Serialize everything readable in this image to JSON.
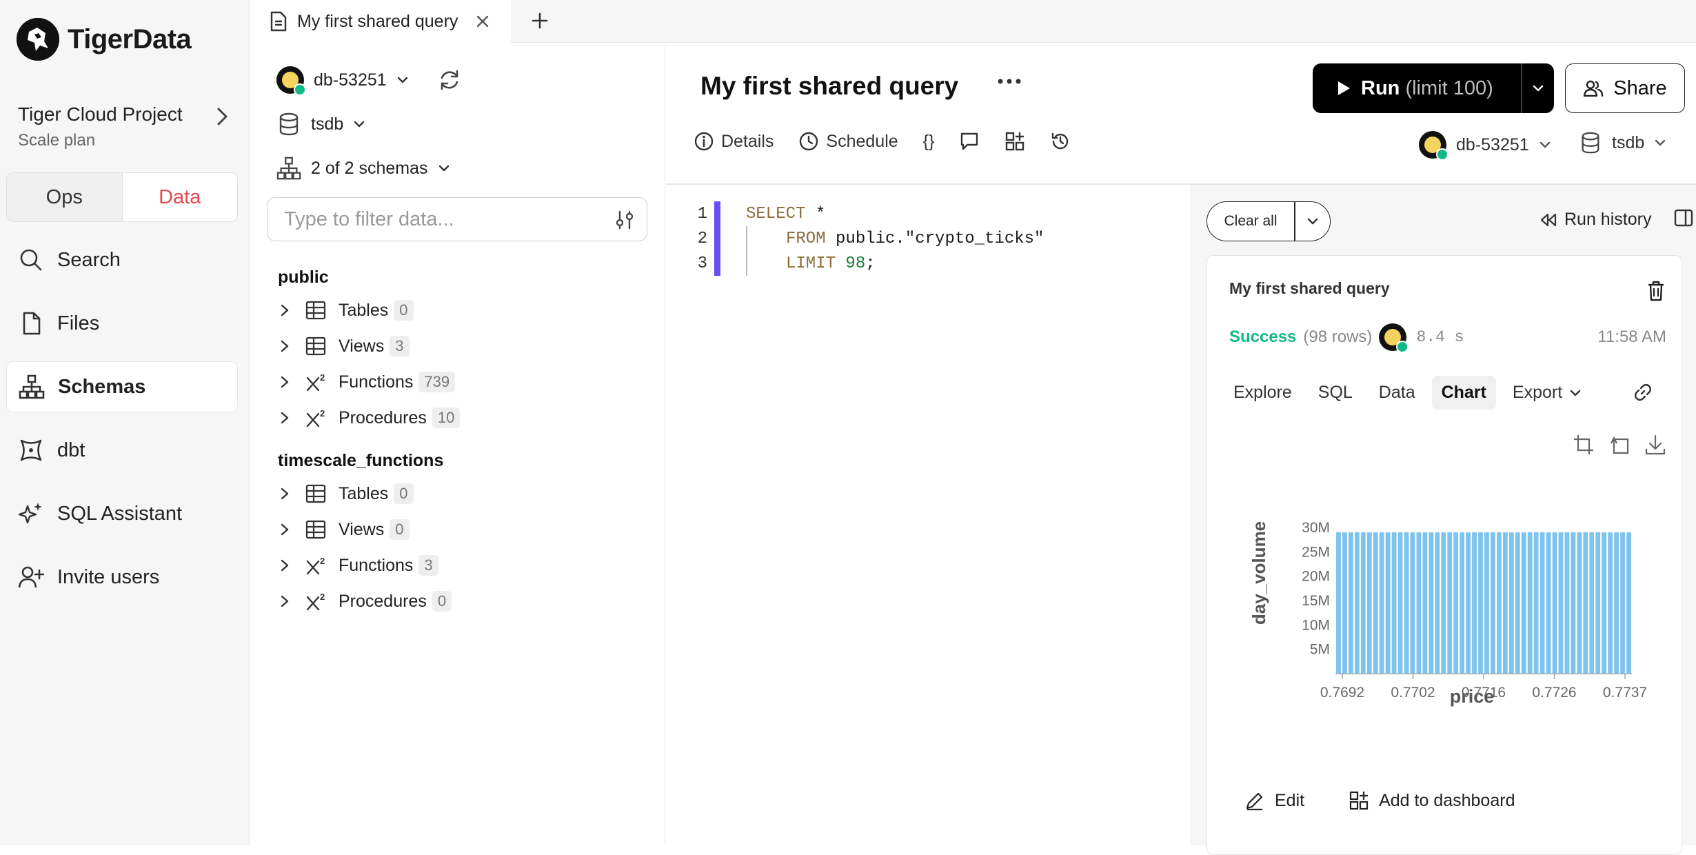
{
  "brand": {
    "name": "TigerData"
  },
  "project": {
    "name": "Tiger Cloud Project",
    "plan": "Scale plan"
  },
  "segment": {
    "ops": "Ops",
    "data": "Data"
  },
  "nav": {
    "search": "Search",
    "files": "Files",
    "schemas": "Schemas",
    "dbt": "dbt",
    "sql_assistant": "SQL Assistant",
    "invite": "Invite users"
  },
  "tabs": {
    "active": "My first shared query"
  },
  "schema_panel": {
    "service": "db-53251",
    "database": "tsdb",
    "schemas": "2 of 2 schemas",
    "filter_placeholder": "Type to filter data...",
    "groups": [
      {
        "name": "public",
        "items": [
          {
            "label": "Tables",
            "count": "0"
          },
          {
            "label": "Views",
            "count": "3"
          },
          {
            "label": "Functions",
            "count": "739"
          },
          {
            "label": "Procedures",
            "count": "10"
          }
        ]
      },
      {
        "name": "timescale_functions",
        "items": [
          {
            "label": "Tables",
            "count": "0"
          },
          {
            "label": "Views",
            "count": "0"
          },
          {
            "label": "Functions",
            "count": "3"
          },
          {
            "label": "Procedures",
            "count": "0"
          }
        ]
      }
    ]
  },
  "query": {
    "title": "My first shared query",
    "run_label": "Run",
    "run_limit": "(limit 100)",
    "share_label": "Share",
    "toolbar": {
      "details": "Details",
      "schedule": "Schedule",
      "braces": "{}"
    },
    "service": "db-53251",
    "database": "tsdb"
  },
  "editor": {
    "lines": [
      {
        "n": "1",
        "kw": "SELECT",
        "rest": " *"
      },
      {
        "n": "2",
        "kw": "FROM",
        "rest": " public.\"crypto_ticks\""
      },
      {
        "n": "3",
        "kw": "LIMIT",
        "num": " 98",
        "rest": ";"
      }
    ]
  },
  "results": {
    "clear_all": "Clear all",
    "run_history": "Run history",
    "card": {
      "title": "My first shared query",
      "status": "Success",
      "rows": "(98 rows)",
      "duration": "8.4 s",
      "time": "11:58 AM",
      "tabs": [
        "Explore",
        "SQL",
        "Data",
        "Chart",
        "Export"
      ],
      "active_tab": "Chart",
      "edit": "Edit",
      "add_dashboard": "Add to dashboard"
    }
  },
  "colors": {
    "accent": "#e5484d",
    "success": "#12b886",
    "bar": "#7ec3ee",
    "editor_marker": "#6b4df5"
  },
  "chart_data": {
    "type": "bar",
    "xlabel": "price",
    "ylabel": "day_volume",
    "x_tick_labels": [
      "0.7692",
      "0.7702",
      "0.7716",
      "0.7726",
      "0.7737"
    ],
    "y_tick_labels": [
      "5M",
      "10M",
      "15M",
      "20M",
      "25M",
      "30M"
    ],
    "ylim": [
      0,
      30000000
    ],
    "bar_count": 48,
    "values": [
      29000000,
      29000000,
      29000000,
      29000000,
      29000000,
      29000000,
      29000000,
      29000000,
      29000000,
      29000000,
      29000000,
      29000000,
      29000000,
      29000000,
      29000000,
      29000000,
      29000000,
      29000000,
      29000000,
      29000000,
      29000000,
      29000000,
      29000000,
      29000000,
      29000000,
      29000000,
      29000000,
      29000000,
      29000000,
      29000000,
      29000000,
      29000000,
      29000000,
      29000000,
      29000000,
      29000000,
      29000000,
      29000000,
      29000000,
      29000000,
      29000000,
      29000000,
      29000000,
      29000000,
      29000000,
      29000000,
      29000000,
      29000000
    ],
    "grid": false
  }
}
